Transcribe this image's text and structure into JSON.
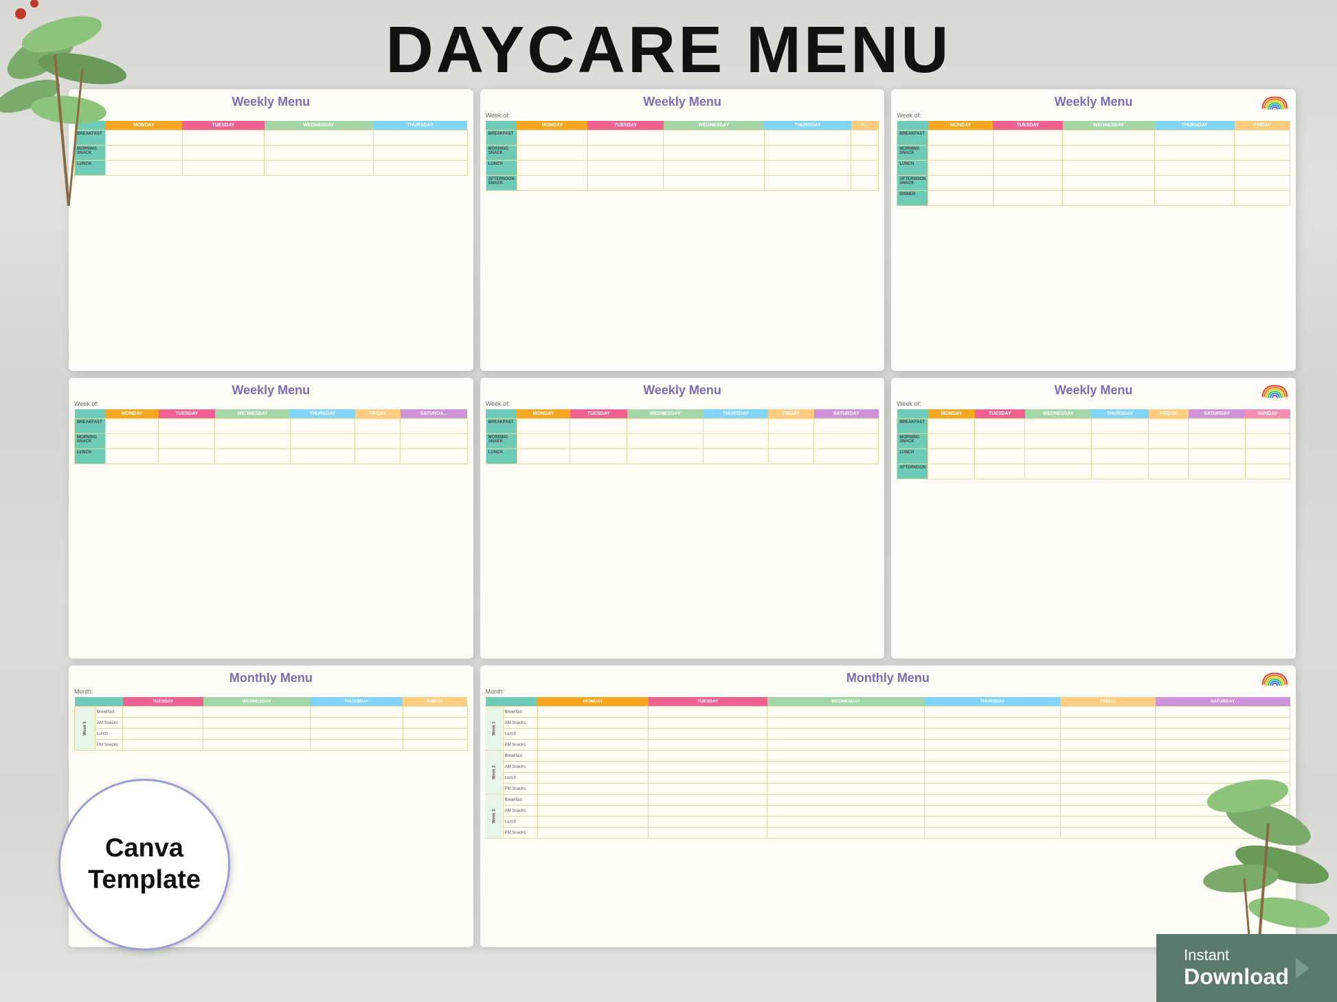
{
  "page": {
    "title": "DAYCARE MENU",
    "background_color": "#d8d8d4"
  },
  "canva_badge": {
    "line1": "Canva",
    "line2": "Template"
  },
  "instant_download": {
    "instant": "Instant",
    "download": "Download"
  },
  "days": {
    "mon": "MONDAY",
    "tue": "TUESDAY",
    "wed": "WEDNESDAY",
    "thu": "THURSDAY",
    "fri": "FRIDAY",
    "sat": "SATURDAY",
    "sun": "SUNDAY"
  },
  "meal_labels": {
    "breakfast": "BREAKFAST",
    "morning_snack": "MORNING SNACK",
    "lunch": "LUNCH",
    "afternoon_snack": "AFTERNOON SNACK",
    "dinner": "DINNER"
  },
  "cards": [
    {
      "id": "card1",
      "title": "Weekly Menu",
      "week_of": "Week of:",
      "days": [
        "MONDAY",
        "TUESDAY",
        "WEDNESDAY",
        "THURSDAY"
      ],
      "meals": [
        "BREAKFAST",
        "MORNING SNACK",
        "LUNCH"
      ],
      "has_rainbow": false
    },
    {
      "id": "card2",
      "title": "Weekly Menu",
      "week_of": "Week of:",
      "days": [
        "MONDAY",
        "TUESDAY",
        "WEDNESDAY",
        "THURSDAY",
        "F..."
      ],
      "meals": [
        "BREAKFAST",
        "MORNING SNACK",
        "LUNCH",
        "AFTERNOON SNACK"
      ],
      "has_rainbow": false
    },
    {
      "id": "card3",
      "title": "Weekly Menu",
      "week_of": "Week of:",
      "days": [
        "MONDAY",
        "TUESDAY",
        "WEDNESDAY",
        "THURSDAY",
        "FRIDAY"
      ],
      "meals": [
        "BREAKFAST",
        "MORNING SNACK",
        "LUNCH",
        "AFTERNOON SNACK",
        "DINNER"
      ],
      "has_rainbow": true
    },
    {
      "id": "card4",
      "title": "Weekly Menu",
      "week_of": "Week of:",
      "days": [
        "MONDAY",
        "TUESDAY",
        "WEDNESDAY",
        "THURSDAY",
        "FRIDAY",
        "SATURDA..."
      ],
      "meals": [
        "BREAKFAST",
        "MORNING SNACK",
        "LUNCH"
      ],
      "has_rainbow": false
    },
    {
      "id": "card5",
      "title": "Weekly Menu",
      "week_of": "Week of:",
      "days": [
        "MONDAY",
        "TUESDAY",
        "WEDNESDAY",
        "THURSDAY",
        "FRIDAY",
        "SATURDAY"
      ],
      "meals": [
        "BREAKFAST",
        "MORNING SNACK",
        "LUNCH"
      ],
      "has_rainbow": false
    },
    {
      "id": "card6",
      "title": "Weekly Menu",
      "week_of": "Week of:",
      "days": [
        "MONDAY",
        "TUESDAY",
        "WEDNESDAY",
        "THURSDAY",
        "FRIDAY",
        "SATURDAY",
        "SUNDAY"
      ],
      "meals": [
        "BREAKFAST",
        "MORNING SNACK",
        "LUNCH",
        "AFTERNOON"
      ],
      "has_rainbow": true
    },
    {
      "id": "card7",
      "title": "Monthly Menu",
      "month": "Month:",
      "days": [
        "TUESDAY",
        "WEDNESDAY",
        "THURSDAY",
        "FRIDAY"
      ],
      "weeks": [
        "Week 5"
      ],
      "meals_per_week": [
        "Breakfast",
        "AM Snacks",
        "Lunch",
        "PM Snacks"
      ],
      "has_rainbow": false
    },
    {
      "id": "card8",
      "title": "Monthly Menu",
      "month": "Month:",
      "days": [
        "MONDAY",
        "TUESDAY",
        "WEDNESDAY",
        "THURSDAY",
        "FRIDAY",
        "SATURDAY"
      ],
      "weeks": [
        "Week 1",
        "Week 2",
        "Week 3"
      ],
      "meals_per_week": [
        "Breakfast",
        "AM Snacks",
        "Lunch",
        "PM Snacks"
      ],
      "has_rainbow": true
    }
  ]
}
